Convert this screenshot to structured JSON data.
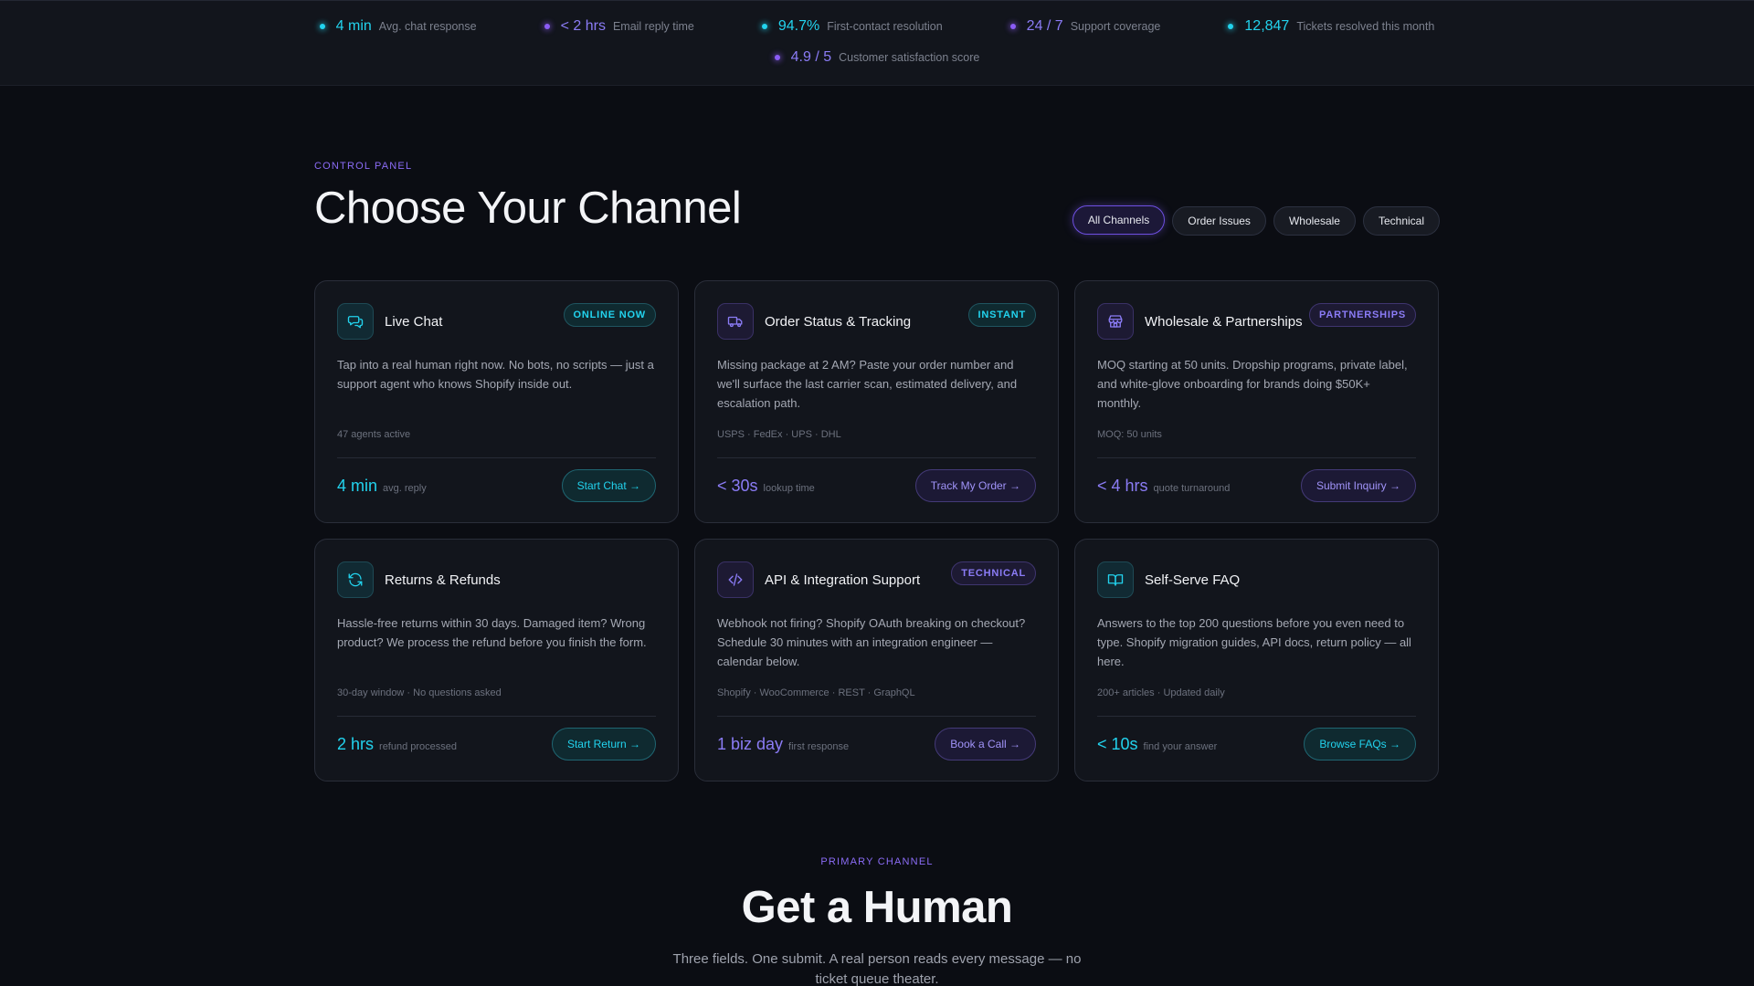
{
  "stats": {
    "row1": [
      {
        "value": "4 min",
        "label": "Avg. chat response",
        "color": "cyan"
      },
      {
        "value": "< 2 hrs",
        "label": "Email reply time",
        "color": "purple"
      },
      {
        "value": "94.7%",
        "label": "First-contact resolution",
        "color": "cyan"
      },
      {
        "value": "24 / 7",
        "label": "Support coverage",
        "color": "purple"
      },
      {
        "value": "12,847",
        "label": "Tickets resolved this month",
        "color": "cyan"
      }
    ],
    "row2": [
      {
        "value": "4.9 / 5",
        "label": "Customer satisfaction score",
        "color": "purple"
      }
    ]
  },
  "channels": {
    "eyebrow": "CONTROL PANEL",
    "title": "Choose Your Channel",
    "filters": [
      "All Channels",
      "Order Issues",
      "Wholesale",
      "Technical"
    ],
    "active_filter": "All Channels",
    "cards": [
      {
        "title": "Live Chat",
        "icon": "chat-icon",
        "accent": "cyan",
        "badge": "ONLINE NOW",
        "badge_color": "cyan",
        "desc": "Tap into a real human right now. No bots, no scripts — just a support agent who knows Shopify inside out.",
        "meta": "47 agents active",
        "metric_value": "4 min",
        "metric_label": "avg. reply",
        "cta": "Start Chat →",
        "cta_color": "cyan"
      },
      {
        "title": "Order Status & Tracking",
        "icon": "truck-icon",
        "accent": "purple",
        "badge": "INSTANT",
        "badge_color": "cyan",
        "desc": "Missing package at 2 AM? Paste your order number and we'll surface the last carrier scan, estimated delivery, and escalation path.",
        "meta": "USPS · FedEx · UPS · DHL",
        "metric_value": "< 30s",
        "metric_label": "lookup time",
        "cta": "Track My Order →",
        "cta_color": "purple"
      },
      {
        "title": "Wholesale & Partnerships",
        "icon": "store-icon",
        "accent": "purple",
        "badge": "PARTNERSHIPS",
        "badge_color": "purple",
        "desc": "MOQ starting at 50 units. Dropship programs, private label, and white-glove onboarding for brands doing $50K+ monthly.",
        "meta": "MOQ: 50 units",
        "metric_value": "< 4 hrs",
        "metric_label": "quote turnaround",
        "cta": "Submit Inquiry →",
        "cta_color": "purple"
      },
      {
        "title": "Returns & Refunds",
        "icon": "refresh-icon",
        "accent": "cyan",
        "badge": "",
        "badge_color": "cyan",
        "desc": "Hassle-free returns within 30 days. Damaged item? Wrong product? We process the refund before you finish the form.",
        "meta": "30-day window · No questions asked",
        "metric_value": "2 hrs",
        "metric_label": "refund processed",
        "cta": "Start Return →",
        "cta_color": "cyan"
      },
      {
        "title": "API & Integration Support",
        "icon": "code-icon",
        "accent": "purple",
        "badge": "TECHNICAL",
        "badge_color": "purple",
        "desc": "Webhook not firing? Shopify OAuth breaking on checkout? Schedule 30 minutes with an integration engineer — calendar below.",
        "meta": "Shopify · WooCommerce · REST · GraphQL",
        "metric_value": "1 biz day",
        "metric_label": "first response",
        "cta": "Book a Call →",
        "cta_color": "purple"
      },
      {
        "title": "Self-Serve FAQ",
        "icon": "book-icon",
        "accent": "cyan",
        "badge": "",
        "badge_color": "cyan",
        "desc": "Answers to the top 200 questions before you even need to type. Shopify migration guides, API docs, return policy — all here.",
        "meta": "200+ articles · Updated daily",
        "metric_value": "< 10s",
        "metric_label": "find your answer",
        "cta": "Browse FAQs →",
        "cta_color": "cyan"
      }
    ]
  },
  "primary": {
    "eyebrow": "PRIMARY CHANNEL",
    "title": "Get a Human",
    "subtitle": "Three fields. One submit. A real person reads every message — no ticket queue theater."
  },
  "colors": {
    "background": "#0b0d13",
    "card": "#12151c",
    "cyan_accent": "#22d3ee",
    "purple_accent": "#8b7cf6"
  }
}
